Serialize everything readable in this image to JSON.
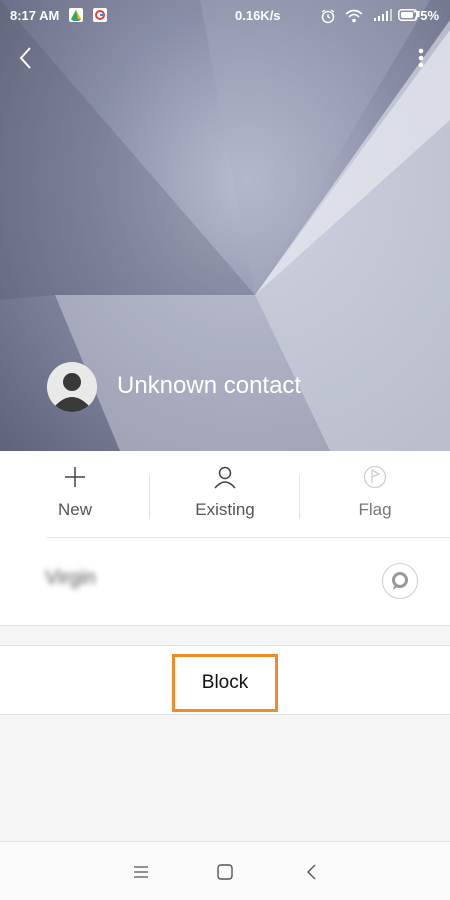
{
  "status_bar": {
    "time": "8:17 AM",
    "network_speed": "0.16K/s",
    "battery_percent": "75%",
    "icons": [
      "drive-icon",
      "google-icon",
      "alarm-icon",
      "wifi-icon",
      "signal-icon",
      "battery-icon"
    ]
  },
  "header": {
    "contact_name": "Unknown contact",
    "icons": [
      "back-arrow-icon",
      "more-vert-icon",
      "avatar-icon"
    ]
  },
  "actions": [
    {
      "label": "New",
      "icon": "plus-icon",
      "enabled": true
    },
    {
      "label": "Existing",
      "icon": "person-icon",
      "enabled": true
    },
    {
      "label": "Flag",
      "icon": "flag-icon",
      "enabled": false
    }
  ],
  "number_row": {
    "number": "Virgin",
    "message_icon": "message-bubble-icon"
  },
  "block": {
    "label": "Block",
    "highlight_color": "#f08a2a"
  },
  "nav_bar": {
    "icons": [
      "menu-icon",
      "home-icon",
      "back-icon"
    ]
  }
}
